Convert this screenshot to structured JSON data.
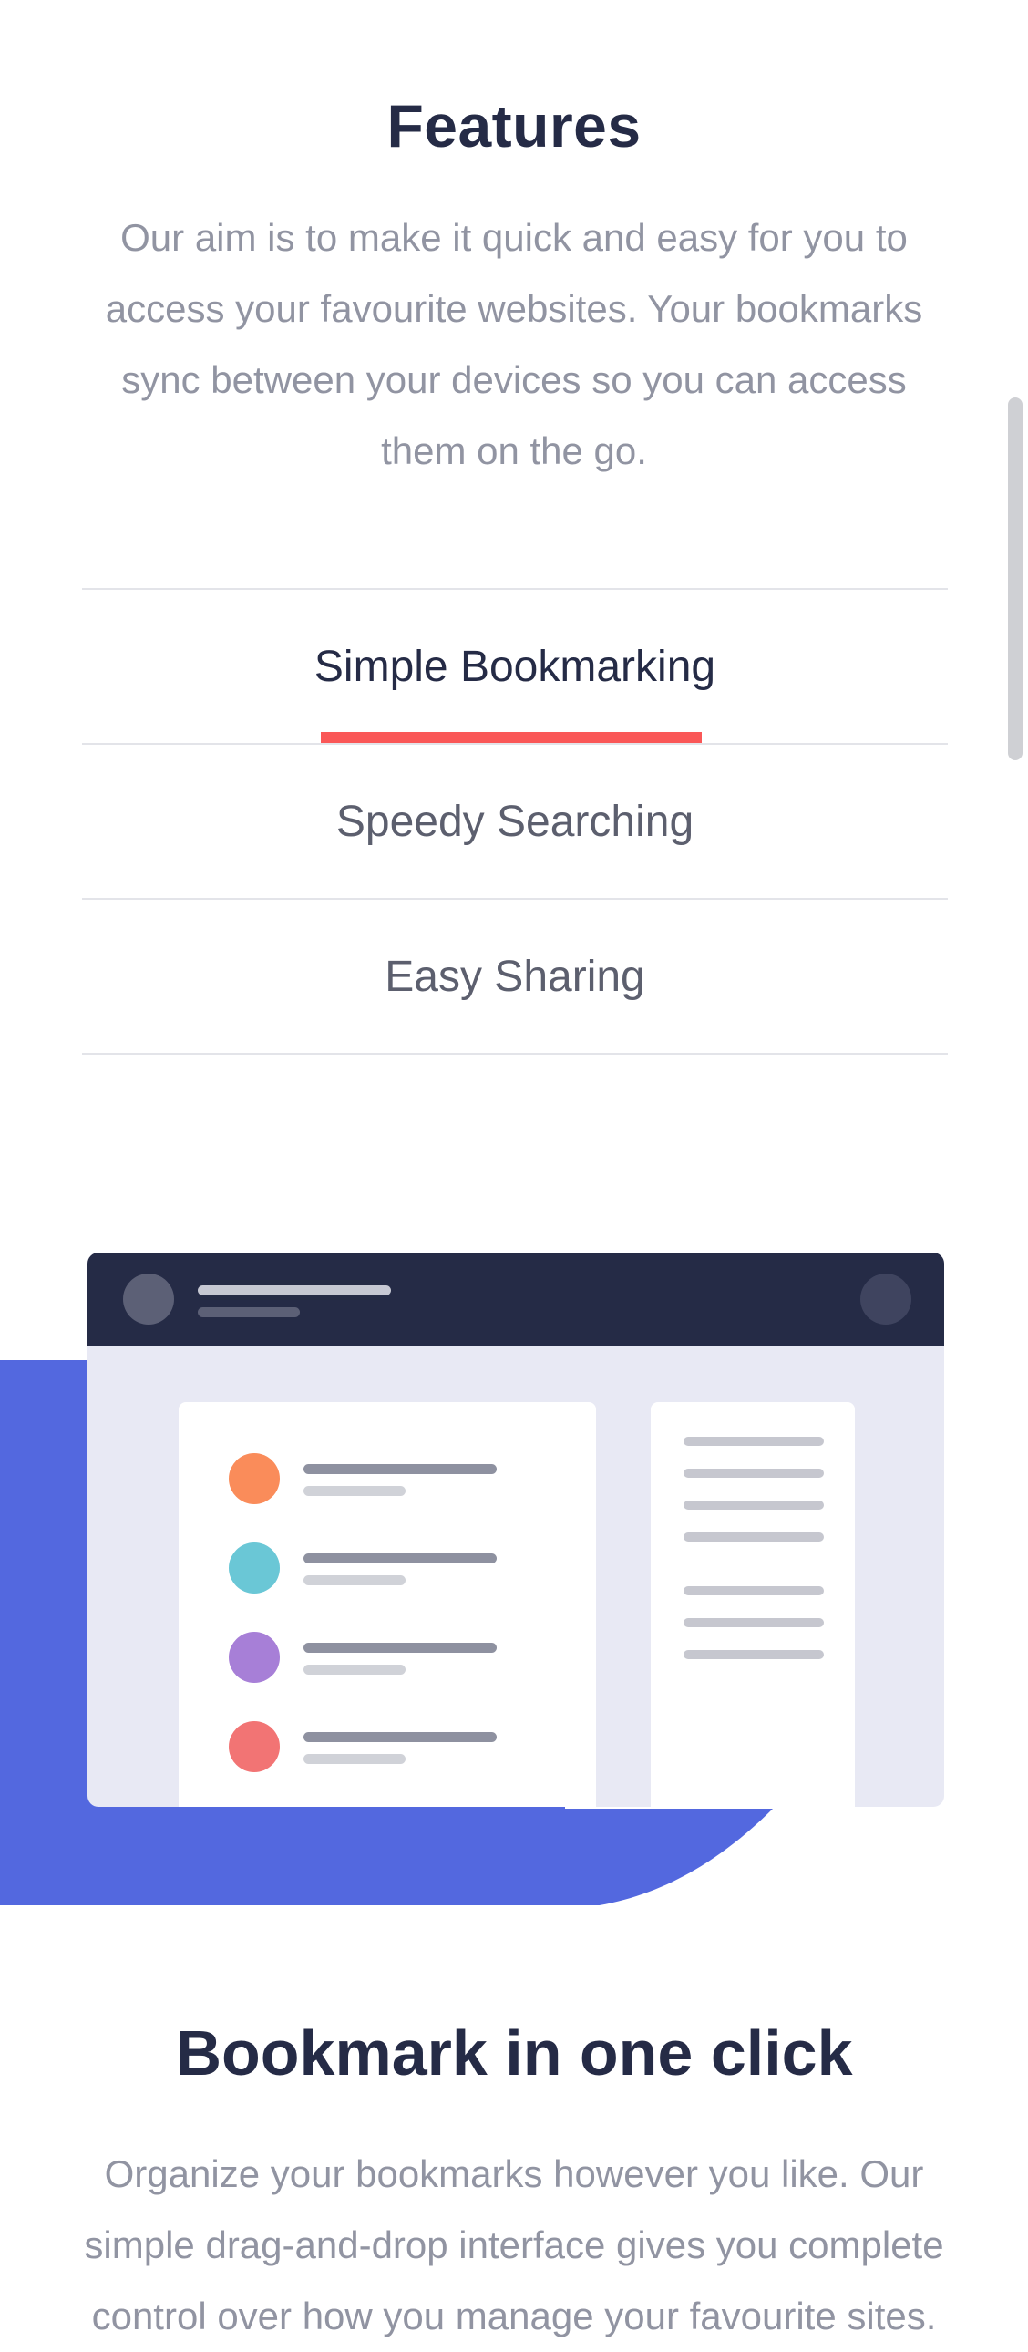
{
  "features": {
    "title": "Features",
    "description": "Our aim is to make it quick and easy for you to access your favourite websites. Your bookmarks sync between your devices so you can access them on the go."
  },
  "tabs": [
    {
      "label": "Simple Bookmarking",
      "active": true
    },
    {
      "label": "Speedy Searching",
      "active": false
    },
    {
      "label": "Easy Sharing",
      "active": false
    }
  ],
  "colors": {
    "accent": "#fa5757",
    "primary": "#5368df",
    "dark": "#252b46"
  },
  "illustration": {
    "icon": "bookmark-app-illustration",
    "bookmark_dot_colors": [
      "#fa8c5a",
      "#6ac7d6",
      "#a77fd7",
      "#f27474"
    ]
  },
  "section": {
    "title": "Bookmark in one click",
    "description": "Organize your bookmarks however you like. Our simple drag-and-drop interface gives you complete control over how you manage your favourite sites."
  }
}
